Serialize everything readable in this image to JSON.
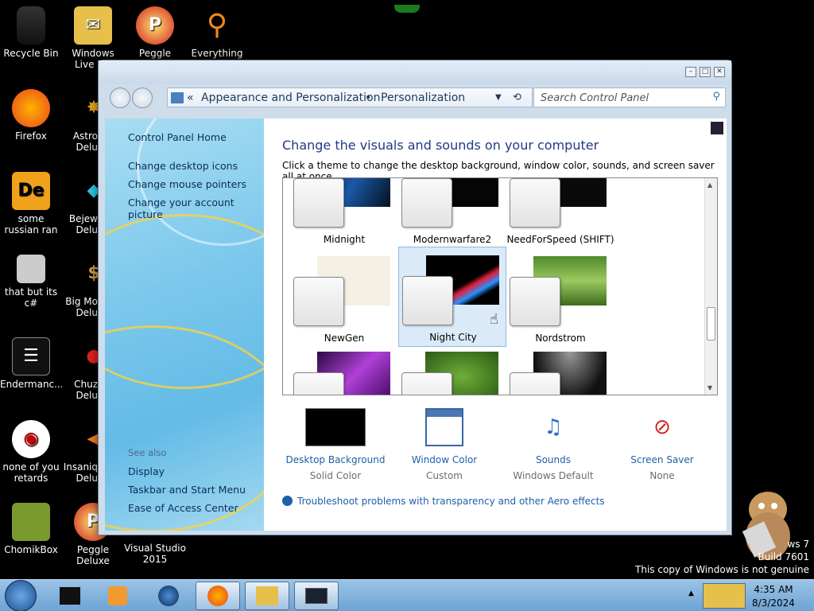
{
  "desktop": {
    "icons": [
      {
        "label": "Recycle Bin"
      },
      {
        "label": "Windows Live Ma"
      },
      {
        "label": "Peggle World"
      },
      {
        "label": "Everything"
      },
      {
        "label": "Firefox"
      },
      {
        "label": "Astro Delu"
      },
      {
        "label": "some russian ran a rat"
      },
      {
        "label": "Bejew Delu"
      },
      {
        "label": "that but its c#"
      },
      {
        "label": "Big Mo Delu"
      },
      {
        "label": "Endermanc..."
      },
      {
        "label": "Chuz Delu"
      },
      {
        "label": "none of you retards kno..."
      },
      {
        "label": "Insaniq Delu"
      },
      {
        "label": "ChomikBox"
      },
      {
        "label": "Peggle Deluxe"
      },
      {
        "label": "Visual Studio 2015"
      }
    ],
    "watermark": {
      "line1": "ws 7",
      "line2": "Build 7601",
      "line3": "This copy of Windows is not genuine"
    }
  },
  "window": {
    "breadcrumb": {
      "separator": "«",
      "item1": "Appearance and Personalization",
      "bullet": "•",
      "item2": "Personalization"
    },
    "search_placeholder": "Search Control Panel",
    "sidebar": {
      "home": "Control Panel Home",
      "links": [
        "Change desktop icons",
        "Change mouse pointers",
        "Change your account picture"
      ],
      "see_also": "See also",
      "see_also_links": [
        "Display",
        "Taskbar and Start Menu",
        "Ease of Access Center"
      ]
    },
    "content": {
      "title": "Change the visuals and sounds on your computer",
      "subtitle": "Click a theme to change the desktop background, window color, sounds, and screen saver all at once.",
      "themes": [
        {
          "name": "Midnight"
        },
        {
          "name": "Modernwarfare2"
        },
        {
          "name": "NeedForSpeed (SHIFT)"
        },
        {
          "name": "NewGen"
        },
        {
          "name": "Night City",
          "selected": true
        },
        {
          "name": "Nordstrom"
        },
        {
          "name": ""
        },
        {
          "name": ""
        },
        {
          "name": ""
        }
      ],
      "settings": [
        {
          "name": "Desktop Background",
          "value": "Solid Color"
        },
        {
          "name": "Window Color",
          "value": "Custom"
        },
        {
          "name": "Sounds",
          "value": "Windows Default"
        },
        {
          "name": "Screen Saver",
          "value": "None"
        }
      ],
      "troubleshoot": "Troubleshoot problems with transparency and other Aero effects"
    }
  },
  "taskbar": {
    "time": "4:35 AM",
    "date": "8/3/2024"
  },
  "colors": {
    "accent_link": "#1e5fa8",
    "title_text": "#1e3a87",
    "selection": "#dbeaf8"
  }
}
